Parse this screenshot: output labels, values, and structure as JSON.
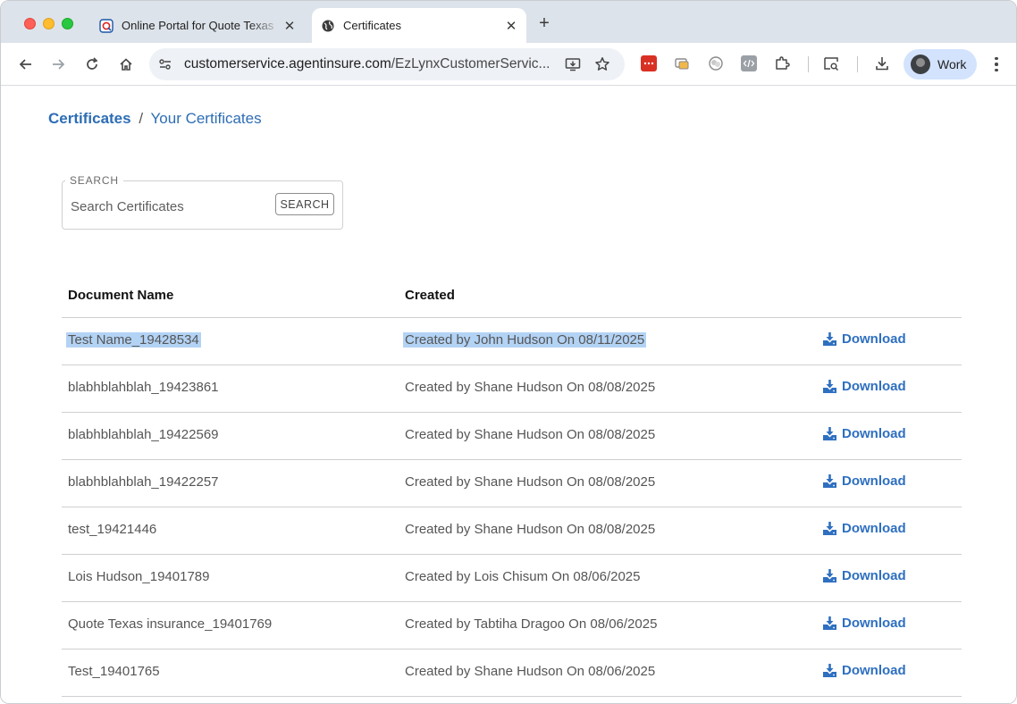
{
  "browser": {
    "tabs": [
      {
        "title": "Online Portal for Quote Texas",
        "active": false
      },
      {
        "title": "Certificates",
        "active": true
      }
    ],
    "url_host": "customerservice.agentinsure.com",
    "url_path": "/EzLynxCustomerServic...",
    "profile_label": "Work"
  },
  "breadcrumb": {
    "root": "Certificates",
    "separator": "/",
    "current": "Your Certificates"
  },
  "search": {
    "legend": "SEARCH",
    "placeholder": "Search Certificates",
    "button_label": "SEARCH"
  },
  "table": {
    "columns": [
      "Document Name",
      "Created"
    ],
    "download_label": "Download",
    "rows": [
      {
        "name": "Test Name_19428534",
        "created": "Created by John Hudson On 08/11/2025",
        "selected": true
      },
      {
        "name": "blabhblahblah_19423861",
        "created": "Created by Shane Hudson On 08/08/2025"
      },
      {
        "name": "blabhblahblah_19422569",
        "created": "Created by Shane Hudson On 08/08/2025"
      },
      {
        "name": "blabhblahblah_19422257",
        "created": "Created by Shane Hudson On 08/08/2025"
      },
      {
        "name": "test_19421446",
        "created": "Created by Shane Hudson On 08/08/2025"
      },
      {
        "name": "Lois Hudson_19401789",
        "created": "Created by Lois Chisum On 08/06/2025"
      },
      {
        "name": "Quote Texas insurance_19401769",
        "created": "Created by Tabtiha Dragoo On 08/06/2025"
      },
      {
        "name": "Test_19401765",
        "created": "Created by Shane Hudson On 08/06/2025"
      }
    ]
  },
  "colors": {
    "accent": "#2d6db5",
    "download": "#2e6fc0",
    "selection": "#b3d3f5"
  }
}
